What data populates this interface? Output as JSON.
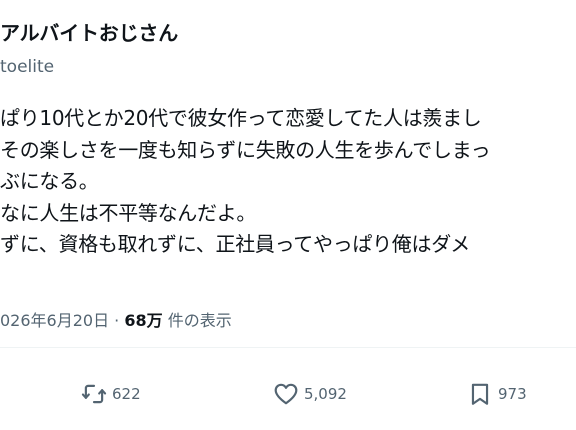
{
  "author": {
    "display_name": "アルバイトおじさん",
    "handle": "toelite"
  },
  "post": {
    "lines": [
      "ぱり10代とか20代で彼女作って恋愛してた人は羨まし",
      "その楽しさを一度も知らずに失敗の人生を歩んでしまっ",
      "ぶになる。",
      "なに人生は不平等なんだよ。",
      "ずに、資格も取れずに、正社員ってやっぱり俺はダメ"
    ]
  },
  "meta": {
    "date": "026年6月20日",
    "separator": " · ",
    "views_count": "68万",
    "views_label": " 件の表示"
  },
  "actions": {
    "retweets": {
      "icon": "retweet-icon",
      "count": "622"
    },
    "likes": {
      "icon": "heart-icon",
      "count": "5,092"
    },
    "bookmarks": {
      "icon": "bookmark-icon",
      "count": "973"
    }
  },
  "colors": {
    "text_primary": "#0f1419",
    "text_secondary": "#536471",
    "divider": "#eff3f4",
    "background": "#ffffff"
  }
}
